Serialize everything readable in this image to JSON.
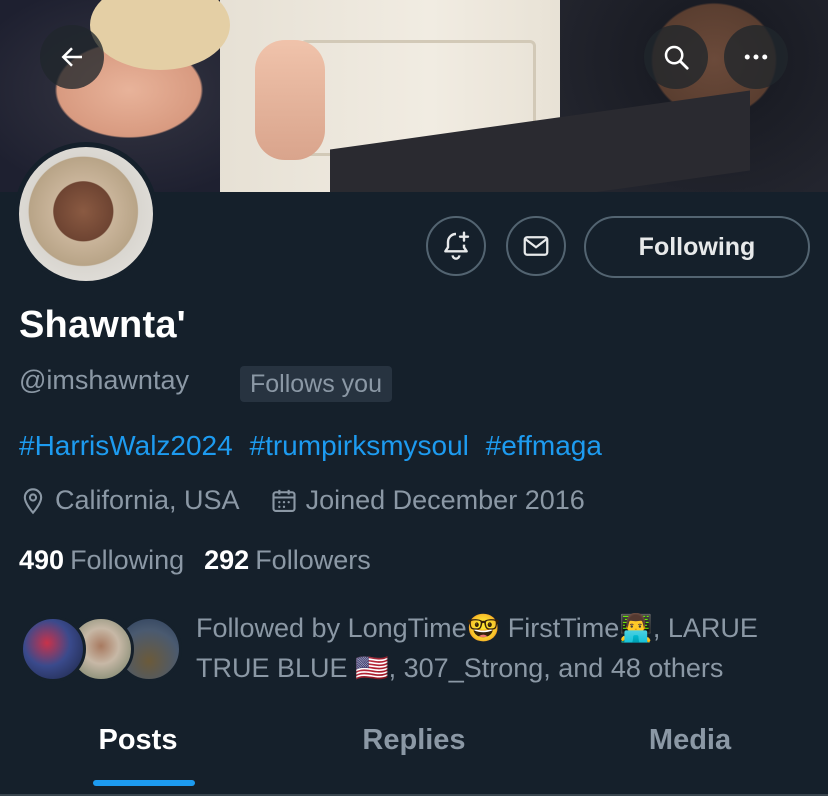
{
  "header": {
    "back_icon": "arrow-left-icon",
    "search_icon": "search-icon",
    "more_icon": "ellipsis-icon"
  },
  "profile": {
    "display_name": "Shawnta'",
    "handle": "@imshawntay",
    "follows_you": "Follows you",
    "bio_hashtags": [
      "#HarrisWalz2024",
      "#trumpirksmysoul",
      "#effmaga"
    ],
    "location": "California, USA",
    "joined": "Joined December 2016",
    "following_count": "490",
    "following_label": "Following",
    "followers_count": "292",
    "followers_label": "Followers",
    "followed_by_text": "Followed by LongTime🤓 FirstTime👨‍💻, LARUE TRUE BLUE 🇺🇸, 307_Strong, and 48 others"
  },
  "actions": {
    "notify_icon": "bell-plus-icon",
    "message_icon": "envelope-icon",
    "following_button": "Following"
  },
  "tabs": [
    {
      "label": "Posts",
      "active": true
    },
    {
      "label": "Replies",
      "active": false
    },
    {
      "label": "Media",
      "active": false
    }
  ],
  "colors": {
    "background": "#15202b",
    "accent": "#1d9bf0",
    "muted_text": "#8b98a5",
    "border": "#536471"
  }
}
